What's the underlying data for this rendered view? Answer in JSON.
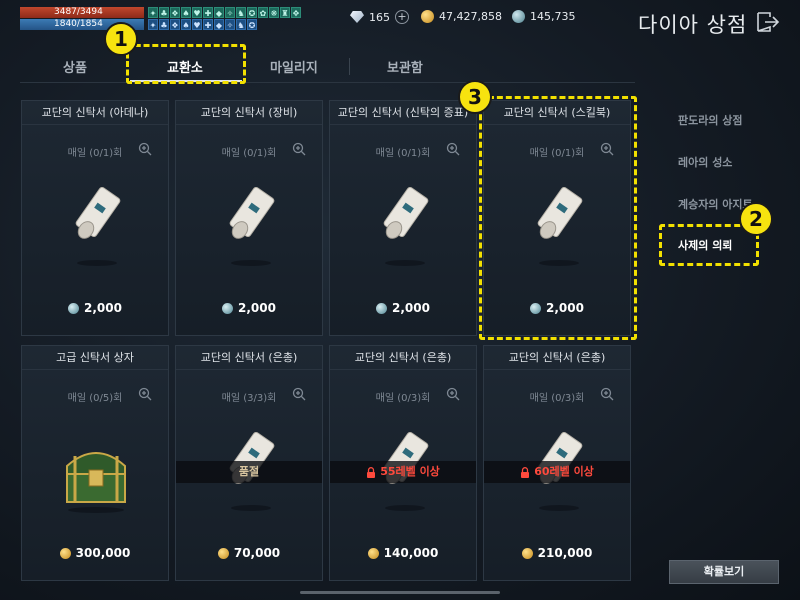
{
  "status": {
    "hp_text": "3487/3494",
    "mp_text": "1840/1854"
  },
  "currency": {
    "diamond": "165",
    "gold": "47,427,858",
    "medal": "145,735"
  },
  "shop": {
    "title": "다이아 상점"
  },
  "tabs": [
    {
      "label": "상품",
      "active": false
    },
    {
      "label": "교환소",
      "active": true
    },
    {
      "label": "마일리지",
      "active": false
    },
    {
      "label": "보관함",
      "active": false
    }
  ],
  "cards": [
    {
      "title": "교단의 신탁서 (아데나)",
      "limit": "매일 (0/1)회",
      "price": "2,000",
      "currency": "medal",
      "item": "scroll",
      "overlay": ""
    },
    {
      "title": "교단의 신탁서 (장비)",
      "limit": "매일 (0/1)회",
      "price": "2,000",
      "currency": "medal",
      "item": "scroll",
      "overlay": ""
    },
    {
      "title": "교단의 신탁서 (신탁의 증표)",
      "limit": "매일 (0/1)회",
      "price": "2,000",
      "currency": "medal",
      "item": "scroll",
      "overlay": ""
    },
    {
      "title": "교단의 신탁서 (스킬북)",
      "limit": "매일 (0/1)회",
      "price": "2,000",
      "currency": "medal",
      "item": "scroll",
      "overlay": ""
    },
    {
      "title": "고급 신탁서 상자",
      "limit": "매일 (0/5)회",
      "price": "300,000",
      "currency": "gold",
      "item": "chest",
      "overlay": ""
    },
    {
      "title": "교단의 신탁서 (은총)",
      "limit": "매일 (3/3)회",
      "price": "70,000",
      "currency": "gold",
      "item": "scroll",
      "overlay": "품절"
    },
    {
      "title": "교단의 신탁서 (은총)",
      "limit": "매일 (0/3)회",
      "price": "140,000",
      "currency": "gold",
      "item": "scroll",
      "overlay": "55레벨 이상"
    },
    {
      "title": "교단의 신탁서 (은총)",
      "limit": "매일 (0/3)회",
      "price": "210,000",
      "currency": "gold",
      "item": "scroll",
      "overlay": "60레벨 이상"
    }
  ],
  "side_menu": [
    {
      "label": "판도라의 상점",
      "active": false
    },
    {
      "label": "레아의 성소",
      "active": false
    },
    {
      "label": "계승자의 아지트",
      "active": false
    },
    {
      "label": "사제의 의뢰",
      "active": true
    }
  ],
  "probability_button": "확률보기",
  "callouts": [
    "1",
    "2",
    "3"
  ],
  "colors": {
    "callout": "#f2e000",
    "locked_text": "#ff4a3d",
    "hp": "#c0472d",
    "mp": "#3c7bb5"
  }
}
